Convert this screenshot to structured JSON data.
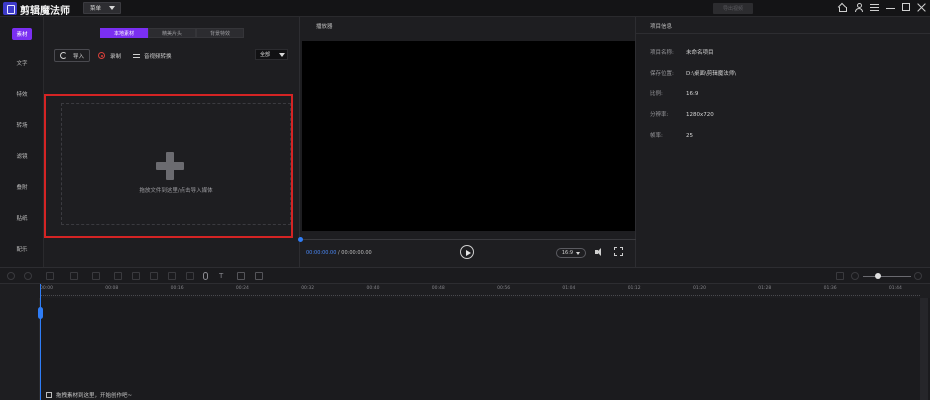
{
  "app": {
    "title": "剪辑魔法师",
    "menu_label": "菜单",
    "export_label": "导出视频"
  },
  "sidebar": {
    "items": [
      {
        "label": "素材",
        "active": true
      },
      {
        "label": "文字"
      },
      {
        "label": "特效"
      },
      {
        "label": "转场"
      },
      {
        "label": "滤镜"
      },
      {
        "label": "叠附"
      },
      {
        "label": "贴纸"
      },
      {
        "label": "配乐"
      }
    ]
  },
  "media": {
    "tabs": [
      {
        "label": "本地素材",
        "active": true
      },
      {
        "label": "精美片头"
      },
      {
        "label": "背景特效"
      }
    ],
    "import_label": "导入",
    "record_label": "录制",
    "convert_label": "音视频转换",
    "filter_value": "全部",
    "drop_hint": "拖放文件到这里/点击导入媒体"
  },
  "player": {
    "title": "播放器",
    "current_time": "00:00:00.00",
    "total_time": "00:00:00.00",
    "time_separator": " / ",
    "ratio": "16:9",
    "progress": 0
  },
  "project_info": {
    "title": "项目信息",
    "rows": [
      {
        "key": "项目名称:",
        "value": "未命名项目"
      },
      {
        "key": "保存位置:",
        "value": "D:\\桌面\\剪辑魔法师\\"
      },
      {
        "key": "比例:",
        "value": "16:9"
      },
      {
        "key": "分辨率:",
        "value": "1280x720"
      },
      {
        "key": "帧率:",
        "value": "25"
      }
    ]
  },
  "timeline": {
    "ticks": [
      "00:00",
      "00:08",
      "00:16",
      "00:24",
      "00:32",
      "00:40",
      "00:48",
      "00:56",
      "01:04",
      "01:12",
      "01:20",
      "01:28",
      "01:36",
      "01:44"
    ],
    "drag_hint": "拖拽素材到这里，开始创作吧~",
    "zoom": 0.25
  },
  "colors": {
    "accent": "#7b2ff2",
    "playhead": "#2f7df6",
    "drop_border": "#d42424"
  }
}
